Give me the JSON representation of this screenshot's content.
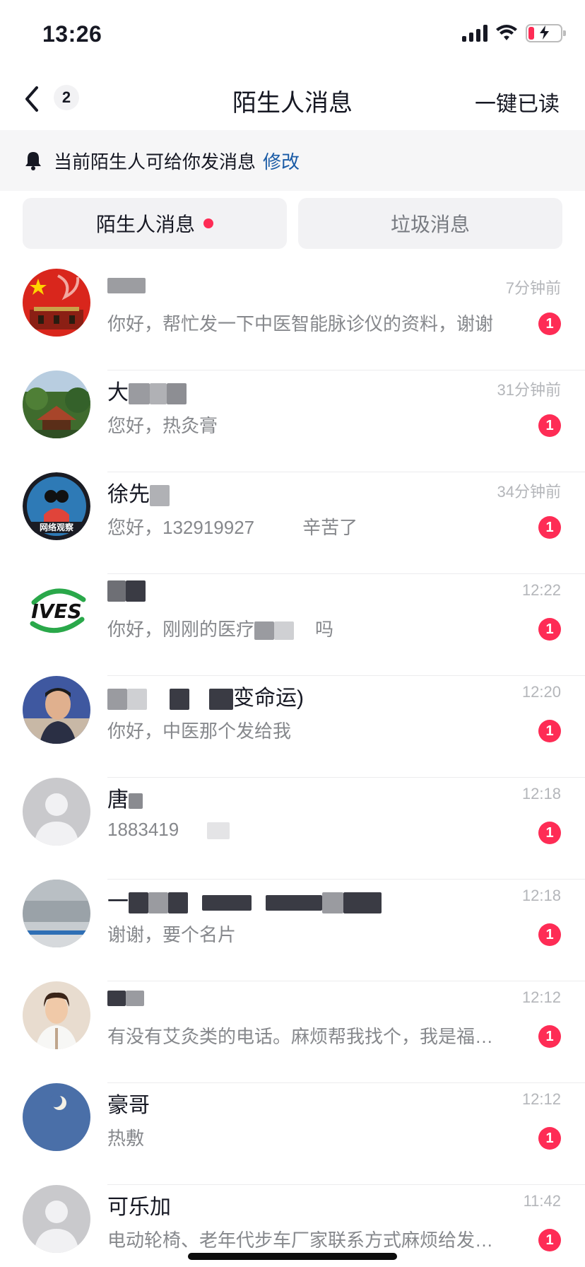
{
  "status_bar": {
    "time": "13:26"
  },
  "nav": {
    "back_count": "2",
    "title": "陌生人消息",
    "read_all": "一键已读"
  },
  "notice": {
    "text": "当前陌生人可给你发消息",
    "link": "修改"
  },
  "tabs": [
    {
      "label": "陌生人消息",
      "active": true,
      "dot": true
    },
    {
      "label": "垃圾消息",
      "active": false,
      "dot": false
    }
  ],
  "messages": [
    {
      "name": "",
      "time": "7分钟前",
      "preview": "你好，帮忙发一下中医智能脉诊仪的资料，谢谢",
      "unread": "1",
      "avatar": "flag-avatar"
    },
    {
      "name": "大",
      "time": "31分钟前",
      "preview": "您好，热灸膏",
      "unread": "1",
      "avatar": "pavilion-avatar"
    },
    {
      "name": "徐先",
      "time": "34分钟前",
      "preview": "您好，132919927",
      "preview_suffix": "辛苦了",
      "unread": "1",
      "avatar": "observer-avatar"
    },
    {
      "name": "",
      "time": "12:22",
      "preview": "你好，刚刚的医疗",
      "preview_suffix": "吗",
      "unread": "1",
      "avatar": "ives-avatar"
    },
    {
      "name": "",
      "name_suffix": "变命运)",
      "time": "12:20",
      "preview": "你好，中医那个发给我",
      "unread": "1",
      "avatar": "man-avatar"
    },
    {
      "name": "唐",
      "time": "12:18",
      "preview": "1883419",
      "unread": "1",
      "avatar": "default-avatar"
    },
    {
      "name": "一",
      "time": "12:18",
      "preview": "谢谢，要个名片",
      "unread": "1",
      "avatar": "sky-avatar"
    },
    {
      "name": "",
      "time": "12:12",
      "preview": "有没有艾灸类的电话。麻烦帮我找个，我是福…",
      "unread": "1",
      "avatar": "woman-avatar"
    },
    {
      "name": "豪哥",
      "time": "12:12",
      "preview": "热敷",
      "unread": "1",
      "avatar": "moon-avatar"
    },
    {
      "name": "可乐加",
      "time": "11:42",
      "preview": "电动轮椅、老年代步车厂家联系方式麻烦给发…",
      "unread": "1",
      "avatar": "default-avatar"
    }
  ],
  "colors": {
    "accent": "#fe2c55",
    "link": "#1a5ba6",
    "text": "#161823",
    "secondary": "#86888c"
  }
}
